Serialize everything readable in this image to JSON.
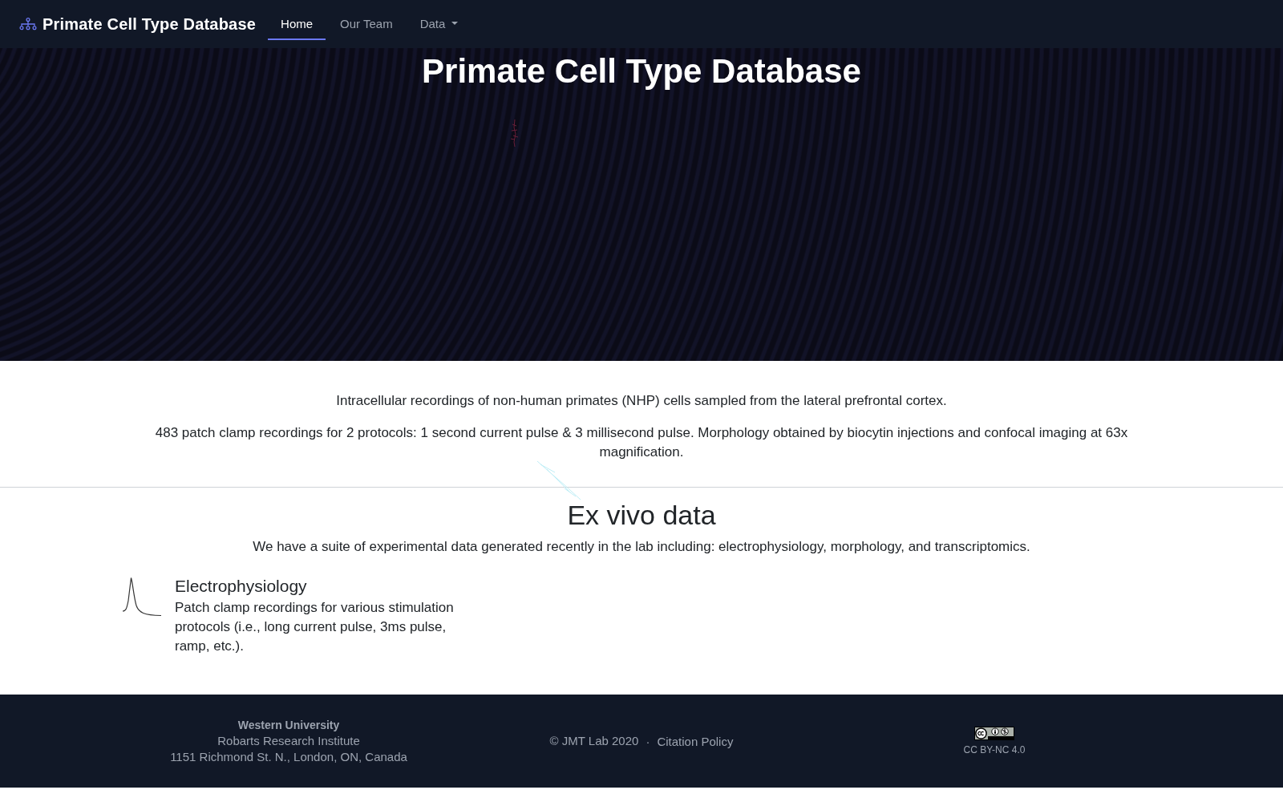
{
  "navbar": {
    "brand": "Primate Cell Type Database",
    "links": [
      {
        "label": "Home",
        "kind": "link",
        "selected": true
      },
      {
        "label": "Our Team",
        "kind": "link",
        "selected": false
      },
      {
        "label": "Data",
        "kind": "dropdown",
        "selected": false
      }
    ]
  },
  "hero": {
    "title": "Primate Cell Type Database"
  },
  "intro": {
    "paragraphs": [
      "Intracellular recordings of non-human primates (NHP) cells sampled from the lateral prefrontal cortex.",
      "483 patch clamp recordings for 2 protocols: 1 second current pulse & 3 millisecond pulse. Morphology obtained by biocytin injections and confocal imaging at 63x magnification."
    ]
  },
  "ex_vivo": {
    "title": "Ex vivo data",
    "description": "We have a suite of experimental data generated recently in the lab including: electrophysiology, morphology, and transcriptomics.",
    "items": [
      {
        "title": "Electrophysiology",
        "description": "Patch clamp recordings for various stimulation protocols (i.e., long current pulse, 3ms pulse, ramp, etc.)."
      }
    ]
  },
  "footer": {
    "institution": "Western University",
    "department": "Robarts Research Institute",
    "address": "1151 Richmond St. N., London, ON, Canada",
    "copyright": "© JMT Lab 2020",
    "separator": "·",
    "citation_link": "Citation Policy",
    "license": "CC BY-NC 4.0"
  }
}
